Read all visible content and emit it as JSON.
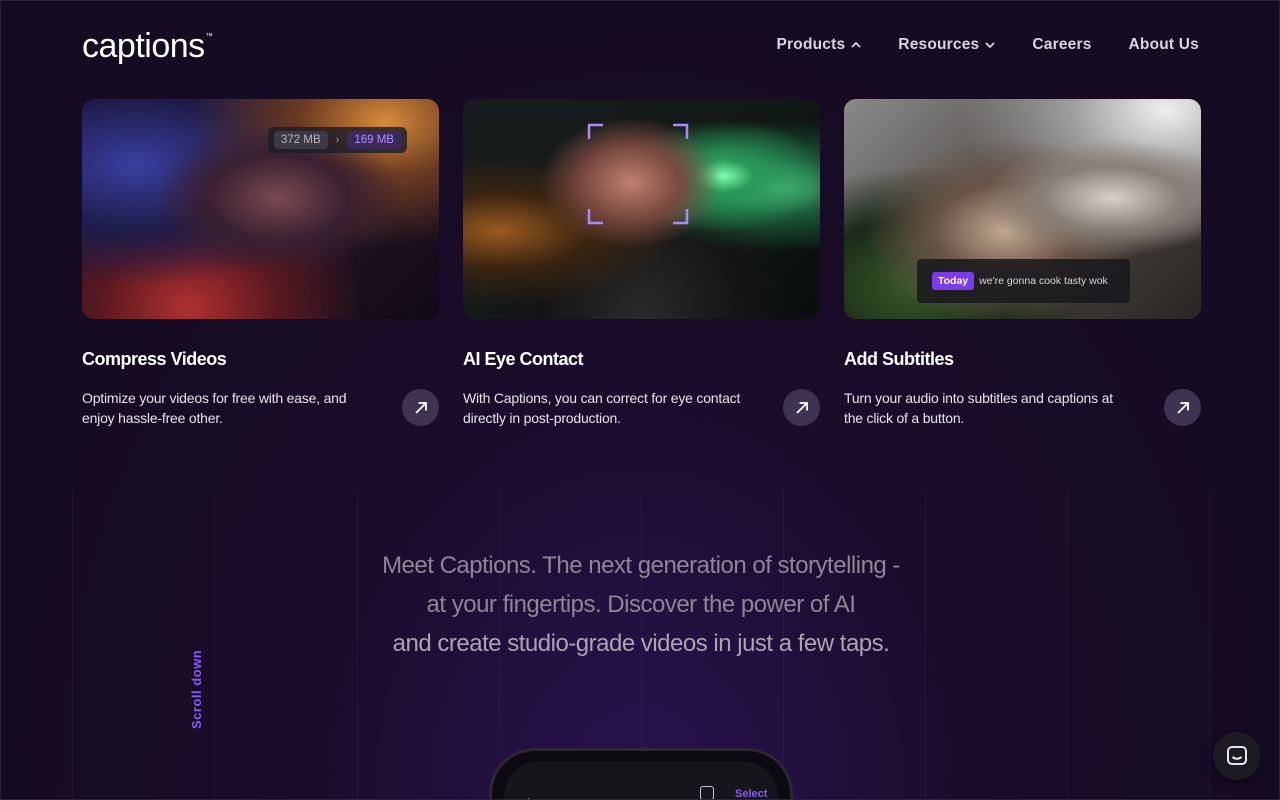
{
  "header": {
    "logo": "captions",
    "logo_tm": "™",
    "nav": [
      {
        "label": "Products",
        "icon": "chevron-up-icon"
      },
      {
        "label": "Resources",
        "icon": "chevron-down-icon"
      },
      {
        "label": "Careers"
      },
      {
        "label": "About Us"
      }
    ]
  },
  "cards": [
    {
      "title": "Compress Videos",
      "description": "Optimize your videos for free with ease, and enjoy hassle-free other.",
      "badge": {
        "old_size": "372 MB",
        "separator": "›",
        "new_size": "169 MB"
      },
      "link_icon": "arrow-up-right-icon"
    },
    {
      "title": "AI Eye Contact",
      "description": "With Captions, you can correct for eye contact directly in post-production.",
      "link_icon": "arrow-up-right-icon"
    },
    {
      "title": "Add Subtitles",
      "description": "Turn your audio into subtitles and captions at the click of a button.",
      "subtitle_overlay": {
        "tag": "Today",
        "text": "we're gonna cook tasty wok"
      },
      "link_icon": "arrow-up-right-icon"
    }
  ],
  "hero": {
    "line1": "Meet Captions. The next generation of storytelling -",
    "line2": "at your fingertips. Discover the power of AI",
    "line3": "and create studio-grade videos in just a few taps."
  },
  "scroll_hint": "Scroll down",
  "phone": {
    "back": "←",
    "select": "Select"
  },
  "colors": {
    "accent": "#8b5cf6",
    "background": "#150b22"
  }
}
